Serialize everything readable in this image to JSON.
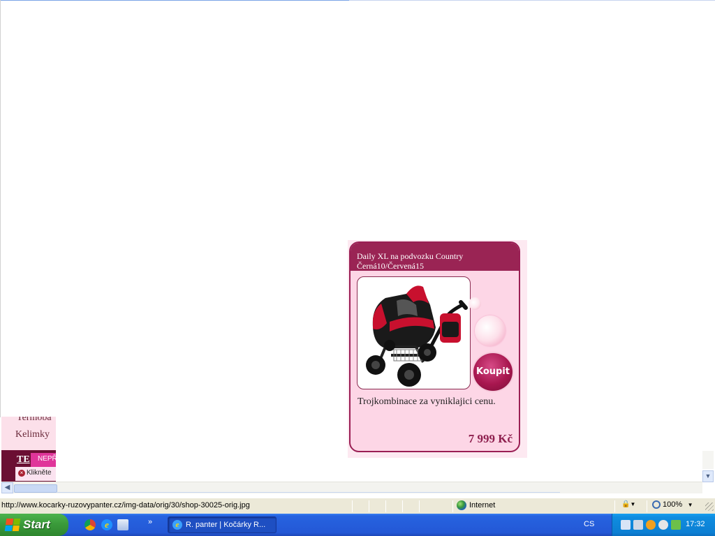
{
  "left_fragment": {
    "text_termo": "Termoba",
    "text_kelimky": "Kelimky",
    "text_te": "TE",
    "text_nepr": "NEPŘ",
    "text_klik": "Klikněte"
  },
  "product_popup": {
    "title_line1": "Daily XL na podvozku Country",
    "title_line2": "Černá10/Červená15",
    "buy_label": "Koupit",
    "description": "Trojkombinace za vyniklajici cenu.",
    "price": "7 999 Kč",
    "image_icon": "stroller-image"
  },
  "statusbar": {
    "url": "http://www.kocarky-ruzovypanter.cz/img-data/orig/30/shop-30025-orig.jpg",
    "zone": "Internet",
    "zoom": "100%"
  },
  "taskbar": {
    "start_label": "Start",
    "task_label": "R. panter | Kočárky R...",
    "more": "»",
    "lang": "CS",
    "clock": "17:32"
  },
  "colors": {
    "accent": "#9a1f54",
    "popup_bg": "#fdd6e6",
    "price": "#8e1f4e"
  }
}
